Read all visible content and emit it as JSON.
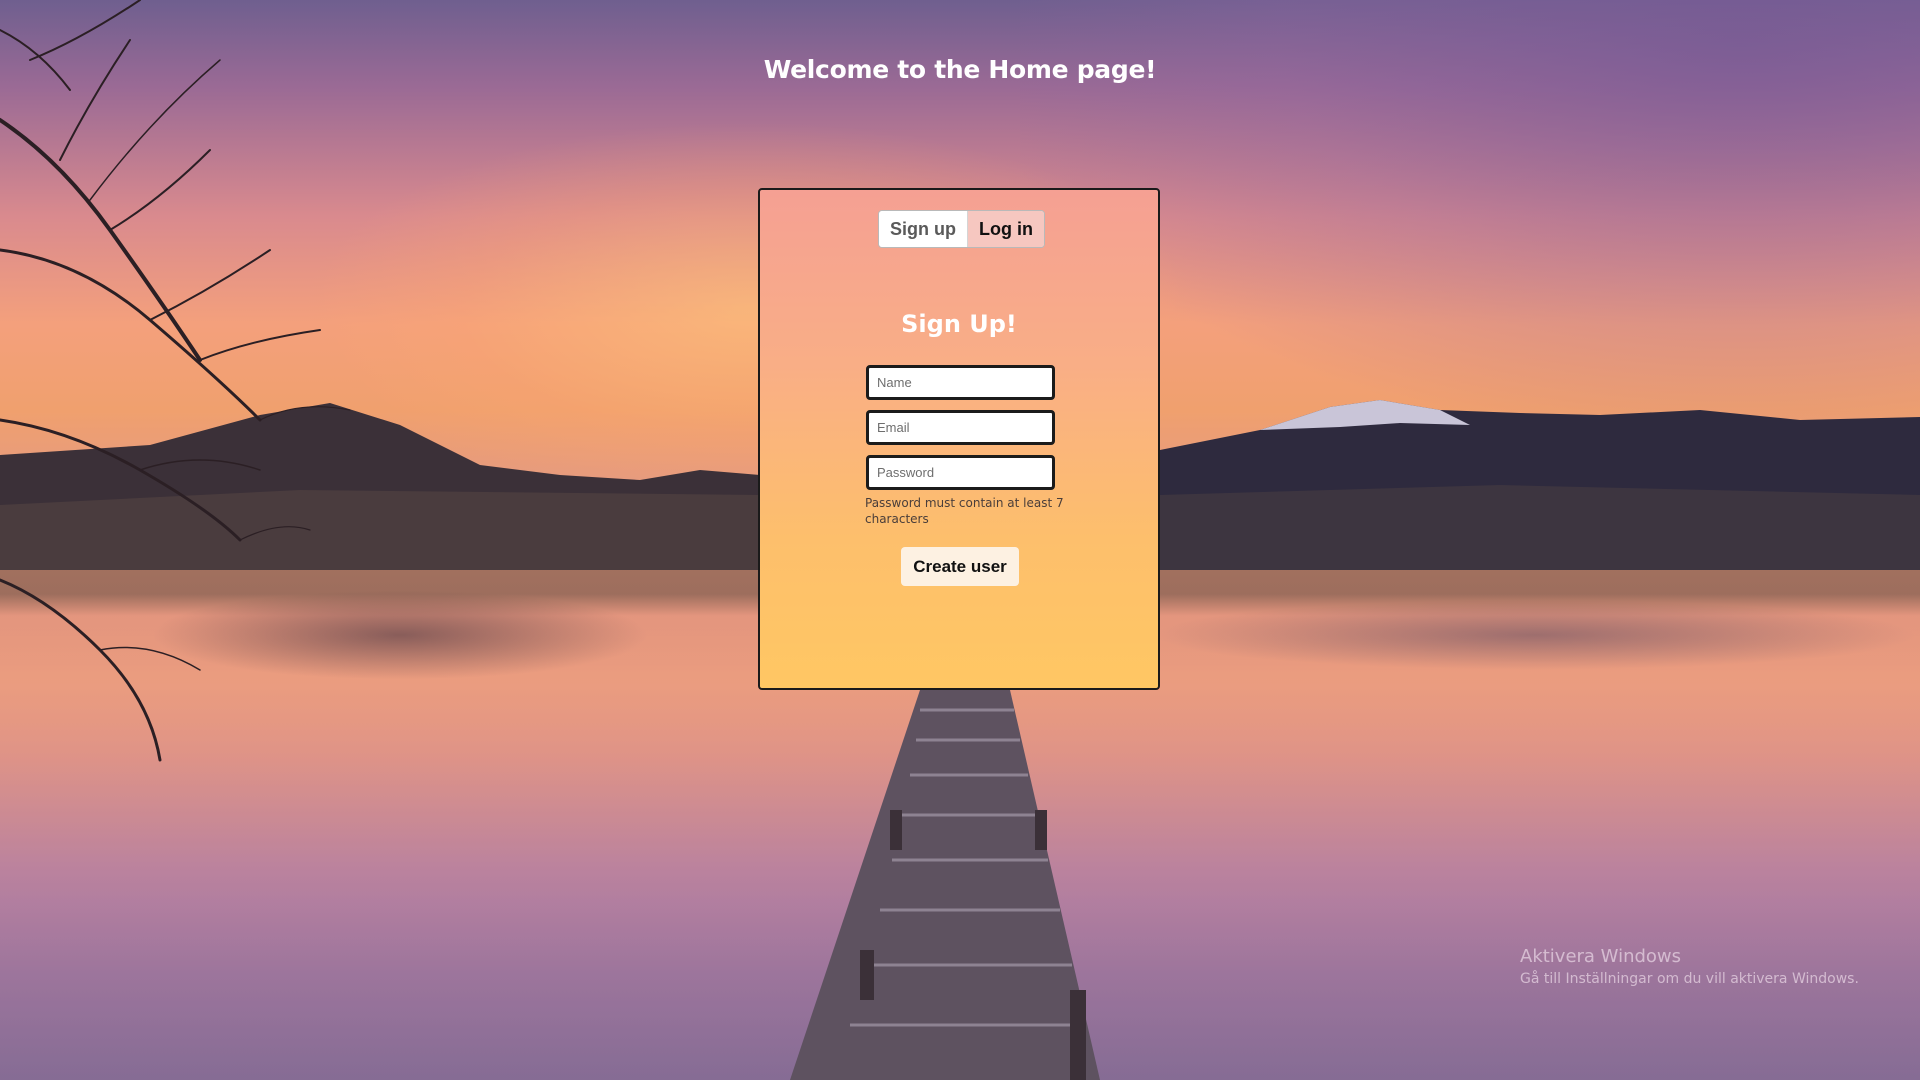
{
  "page": {
    "title": "Welcome to the Home page!"
  },
  "auth_card": {
    "tabs": [
      {
        "label": "Sign up"
      },
      {
        "label": "Log in"
      }
    ],
    "form_title": "Sign Up!",
    "fields": {
      "name_placeholder": "Name",
      "email_placeholder": "Email",
      "password_placeholder": "Password"
    },
    "password_hint": "Password must contain at least 7 characters",
    "submit_label": "Create user"
  },
  "windows_watermark": {
    "title": "Aktivera Windows",
    "subtitle": "Gå till Inställningar om du vill aktivera Windows."
  },
  "background": {
    "description_icon": "sunset-lake-pier-image"
  },
  "colors": {
    "card_gradient_top": "#f5a093",
    "card_gradient_bottom": "#ffc763",
    "tab_active": "#f6c7c0",
    "button_bg": "#fdf1e2"
  }
}
